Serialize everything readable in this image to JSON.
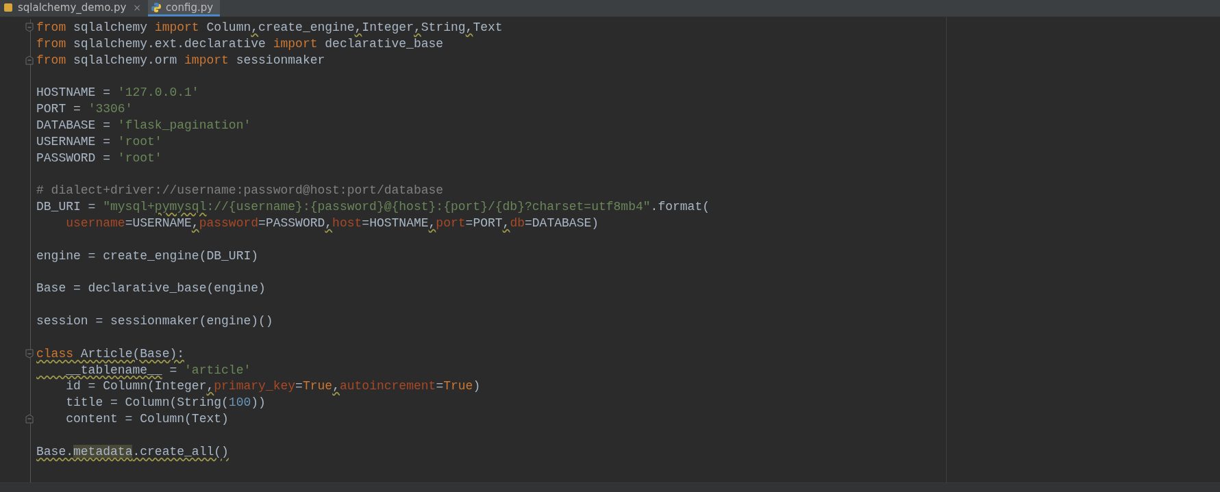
{
  "tabs": [
    {
      "label": "sqlalchemy_demo.py",
      "close": "×",
      "selected": false
    },
    {
      "label": "config.py",
      "selected": true
    }
  ],
  "lines": [
    {
      "kind": "foldstart",
      "tokens": [
        {
          "text": "from",
          "kind": "kw",
          "warning": false
        },
        {
          "text": " sqlalchemy ",
          "kind": "plain",
          "warning": false
        },
        {
          "text": "import",
          "kind": "kw",
          "warning": false
        },
        {
          "text": " Column",
          "kind": "plain",
          "warning": false
        },
        {
          "text": ",",
          "kind": "plain",
          "warning": true
        },
        {
          "text": "create_engine",
          "kind": "plain",
          "warning": false
        },
        {
          "text": ",",
          "kind": "plain",
          "warning": true
        },
        {
          "text": "Integer",
          "kind": "plain",
          "warning": false
        },
        {
          "text": ",",
          "kind": "plain",
          "warning": true
        },
        {
          "text": "String",
          "kind": "plain",
          "warning": false
        },
        {
          "text": ",",
          "kind": "plain",
          "warning": true
        },
        {
          "text": "Text",
          "kind": "plain",
          "warning": false
        }
      ]
    },
    {
      "kind": "code",
      "tokens": [
        {
          "text": "from",
          "kind": "kw",
          "warning": false
        },
        {
          "text": " sqlalchemy.ext.declarative ",
          "kind": "plain",
          "warning": false
        },
        {
          "text": "import",
          "kind": "kw",
          "warning": false
        },
        {
          "text": " declarative_base",
          "kind": "plain",
          "warning": false
        }
      ]
    },
    {
      "kind": "foldend",
      "tokens": [
        {
          "text": "from",
          "kind": "kw",
          "warning": false
        },
        {
          "text": " sqlalchemy.orm ",
          "kind": "plain",
          "warning": false
        },
        {
          "text": "import",
          "kind": "kw",
          "warning": false
        },
        {
          "text": " sessionmaker",
          "kind": "plain",
          "warning": false
        }
      ]
    },
    {
      "kind": "code"
    },
    {
      "kind": "code",
      "tokens": [
        {
          "text": "HOSTNAME = ",
          "kind": "plain",
          "warning": false
        },
        {
          "text": "'127.0.0.1'",
          "kind": "str",
          "warning": false
        }
      ]
    },
    {
      "kind": "code",
      "tokens": [
        {
          "text": "PORT = ",
          "kind": "plain",
          "warning": false
        },
        {
          "text": "'3306'",
          "kind": "str",
          "warning": false
        }
      ]
    },
    {
      "kind": "code",
      "tokens": [
        {
          "text": "DATABASE = ",
          "kind": "plain",
          "warning": false
        },
        {
          "text": "'flask_pagination'",
          "kind": "str",
          "warning": false
        }
      ]
    },
    {
      "kind": "code",
      "tokens": [
        {
          "text": "USERNAME = ",
          "kind": "plain",
          "warning": false
        },
        {
          "text": "'root'",
          "kind": "str",
          "warning": false
        }
      ]
    },
    {
      "kind": "code",
      "tokens": [
        {
          "text": "PASSWORD = ",
          "kind": "plain",
          "warning": false
        },
        {
          "text": "'root'",
          "kind": "str",
          "warning": false
        }
      ]
    },
    {
      "kind": "code"
    },
    {
      "kind": "code",
      "tokens": [
        {
          "text": "# dialect+driver://username:password@host:port/database",
          "kind": "comment",
          "warning": false
        }
      ]
    },
    {
      "kind": "code",
      "tokens": [
        {
          "text": "DB_URI = ",
          "kind": "plain",
          "warning": false
        },
        {
          "text": "\"mysql+",
          "kind": "str",
          "warning": false
        },
        {
          "text": "pymysql",
          "kind": "str",
          "warning": true
        },
        {
          "text": "://{username}:{password}@{host}:{port}/{db}?charset=utf8mb4\"",
          "kind": "str",
          "warning": false
        },
        {
          "text": ".format(",
          "kind": "plain",
          "warning": false
        }
      ]
    },
    {
      "kind": "code",
      "tokens": [
        {
          "text": "    username",
          "kind": "param",
          "warning": false
        },
        {
          "text": "=USERNAME",
          "kind": "plain",
          "warning": false
        },
        {
          "text": ",",
          "kind": "plain",
          "warning": true
        },
        {
          "text": "password",
          "kind": "param",
          "warning": false
        },
        {
          "text": "=PASSWORD",
          "kind": "plain",
          "warning": false
        },
        {
          "text": ",",
          "kind": "plain",
          "warning": true
        },
        {
          "text": "host",
          "kind": "param",
          "warning": false
        },
        {
          "text": "=HOSTNAME",
          "kind": "plain",
          "warning": false
        },
        {
          "text": ",",
          "kind": "plain",
          "warning": true
        },
        {
          "text": "port",
          "kind": "param",
          "warning": false
        },
        {
          "text": "=PORT",
          "kind": "plain",
          "warning": false
        },
        {
          "text": ",",
          "kind": "plain",
          "warning": true
        },
        {
          "text": "db",
          "kind": "param",
          "warning": false
        },
        {
          "text": "=DATABASE)",
          "kind": "plain",
          "warning": false
        }
      ]
    },
    {
      "kind": "code"
    },
    {
      "kind": "code",
      "tokens": [
        {
          "text": "engine = create_engine(DB_URI)",
          "kind": "plain",
          "warning": false
        }
      ]
    },
    {
      "kind": "code"
    },
    {
      "kind": "code",
      "tokens": [
        {
          "text": "Base = declarative_base(engine)",
          "kind": "plain",
          "warning": false
        }
      ]
    },
    {
      "kind": "code"
    },
    {
      "kind": "code",
      "tokens": [
        {
          "text": "session = sessionmaker(engine)()",
          "kind": "plain",
          "warning": false
        }
      ]
    },
    {
      "kind": "code"
    },
    {
      "kind": "foldstart",
      "tokens": [
        {
          "text": "class",
          "kind": "kw",
          "warning": true
        },
        {
          "text": " Article(Base):",
          "kind": "plain",
          "warning": true
        }
      ]
    },
    {
      "kind": "code",
      "tokens": [
        {
          "text": "    __tablename__",
          "kind": "plain",
          "warning": true
        },
        {
          "text": " = ",
          "kind": "plain",
          "warning": false
        },
        {
          "text": "'article'",
          "kind": "str",
          "warning": false
        }
      ]
    },
    {
      "kind": "code",
      "tokens": [
        {
          "text": "    id = Column(Integer",
          "kind": "plain",
          "warning": false
        },
        {
          "text": ",",
          "kind": "plain",
          "warning": true
        },
        {
          "text": "primary_key",
          "kind": "param",
          "warning": false
        },
        {
          "text": "=",
          "kind": "plain",
          "warning": false
        },
        {
          "text": "True",
          "kind": "kw",
          "warning": false
        },
        {
          "text": ",",
          "kind": "plain",
          "warning": true
        },
        {
          "text": "autoincrement",
          "kind": "param",
          "warning": false
        },
        {
          "text": "=",
          "kind": "plain",
          "warning": false
        },
        {
          "text": "True",
          "kind": "kw",
          "warning": false
        },
        {
          "text": ")",
          "kind": "plain",
          "warning": false
        }
      ]
    },
    {
      "kind": "code",
      "tokens": [
        {
          "text": "    title = Column(String(",
          "kind": "plain",
          "warning": false
        },
        {
          "text": "100",
          "kind": "num",
          "warning": false
        },
        {
          "text": "))",
          "kind": "plain",
          "warning": false
        }
      ]
    },
    {
      "kind": "foldend",
      "tokens": [
        {
          "text": "    content = Column(Text)",
          "kind": "plain",
          "warning": false
        }
      ]
    },
    {
      "kind": "code"
    },
    {
      "kind": "code",
      "tokens": [
        {
          "text": "Base.",
          "kind": "plain",
          "warning": true
        },
        {
          "text": "metadata",
          "kind": "ref",
          "warning": true
        },
        {
          "text": ".create_all()",
          "kind": "plain",
          "warning": true
        }
      ]
    }
  ]
}
